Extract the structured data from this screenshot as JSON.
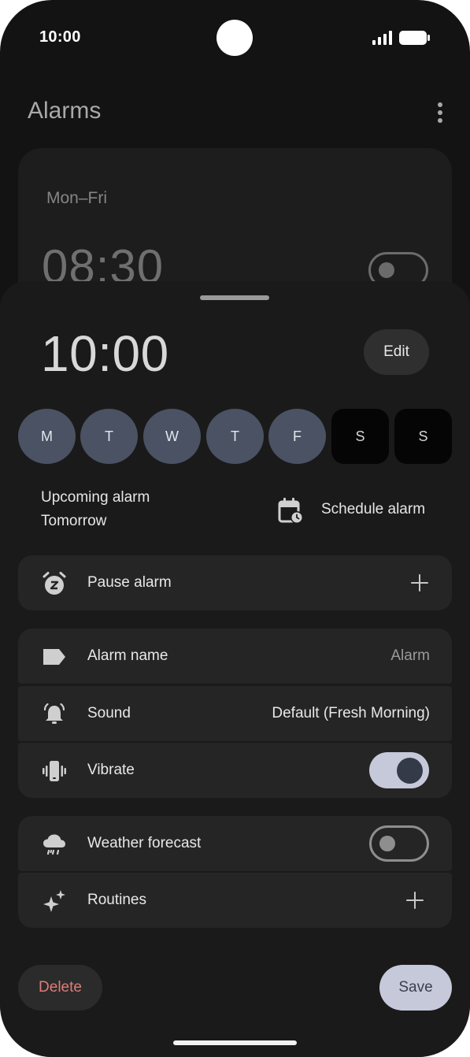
{
  "status_bar": {
    "time": "10:00"
  },
  "header": {
    "title": "Alarms"
  },
  "background_alarm": {
    "days": "Mon–Fri",
    "time": "08:30",
    "enabled": false
  },
  "sheet": {
    "time": "10:00",
    "edit_label": "Edit",
    "days": [
      {
        "letter": "M",
        "selected": true
      },
      {
        "letter": "T",
        "selected": true
      },
      {
        "letter": "W",
        "selected": true
      },
      {
        "letter": "T",
        "selected": true
      },
      {
        "letter": "F",
        "selected": true
      },
      {
        "letter": "S",
        "selected": false
      },
      {
        "letter": "S",
        "selected": false
      }
    ],
    "upcoming": {
      "line1": "Upcoming alarm",
      "line2": "Tomorrow"
    },
    "schedule_label": "Schedule alarm",
    "pause": {
      "label": "Pause alarm"
    },
    "alarm_name": {
      "label": "Alarm name",
      "value": "Alarm"
    },
    "sound": {
      "label": "Sound",
      "value": "Default (Fresh Morning)"
    },
    "vibrate": {
      "label": "Vibrate",
      "enabled": true
    },
    "weather": {
      "label": "Weather forecast",
      "enabled": false
    },
    "routines": {
      "label": "Routines"
    },
    "delete_label": "Delete",
    "save_label": "Save"
  },
  "icons": {
    "pause": "alarm-snooze-icon",
    "alarm_name": "label-tag-icon",
    "sound": "bell-ringing-icon",
    "vibrate": "vibrate-phone-icon",
    "weather": "rain-cloud-icon",
    "routines": "sparkle-icon",
    "schedule": "calendar-clock-icon"
  },
  "colors": {
    "accent": "#c6c9da",
    "day_selected": "#4a5263",
    "delete_text": "#e07b76",
    "sheet_bg": "#1a1a1a",
    "row_bg": "#252525"
  }
}
